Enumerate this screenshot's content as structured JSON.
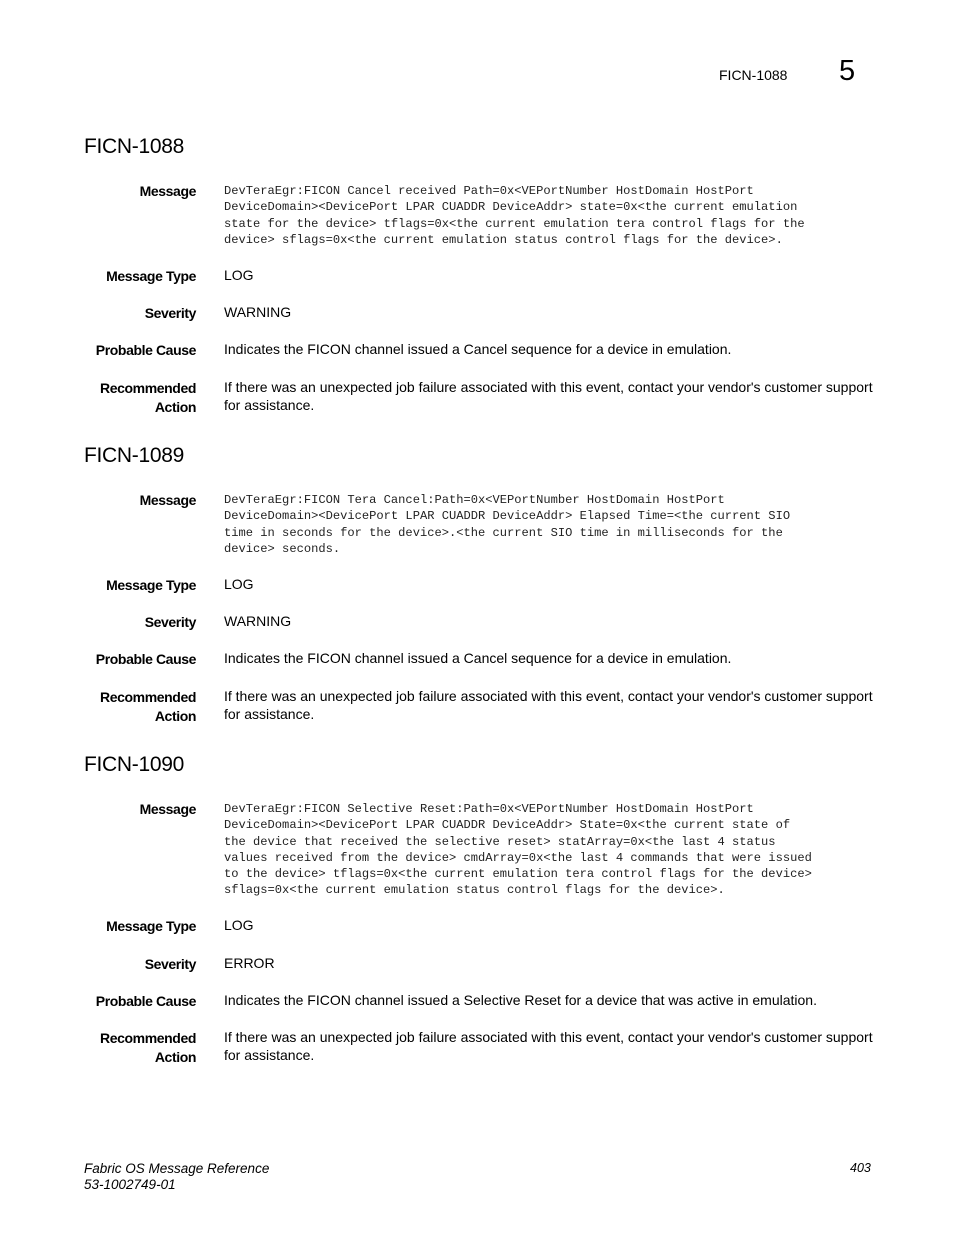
{
  "running_head": {
    "title": "FICN-1088",
    "chapter": "5"
  },
  "labels": {
    "message": "Message",
    "message_type": "Message Type",
    "severity": "Severity",
    "probable_cause": "Probable Cause",
    "recommended_action_line1": "Recommended",
    "recommended_action_line2": "Action"
  },
  "entries": [
    {
      "id": "FICN-1088",
      "message": "DevTeraEgr:FICON Cancel received Path=0x<VEPortNumber HostDomain HostPort\nDeviceDomain><DevicePort LPAR CUADDR DeviceAddr> state=0x<the current emulation\nstate for the device> tflags=0x<the current emulation tera control flags for the\ndevice> sflags=0x<the current emulation status control flags for the device>.",
      "message_type": "LOG",
      "severity": "WARNING",
      "probable_cause": "Indicates the FICON channel issued a Cancel sequence for a device in emulation.",
      "recommended_action": "If there was an unexpected job failure associated with this event, contact your vendor's customer support for assistance."
    },
    {
      "id": "FICN-1089",
      "message": "DevTeraEgr:FICON Tera Cancel:Path=0x<VEPortNumber HostDomain HostPort\nDeviceDomain><DevicePort LPAR CUADDR DeviceAddr> Elapsed Time=<the current SIO\ntime in seconds for the device>.<the current SIO time in milliseconds for the\ndevice> seconds.",
      "message_type": "LOG",
      "severity": "WARNING",
      "probable_cause": "Indicates the FICON channel issued a Cancel sequence for a device in emulation.",
      "recommended_action": "If there was an unexpected job failure associated with this event, contact your vendor's customer support for assistance."
    },
    {
      "id": "FICN-1090",
      "message": "DevTeraEgr:FICON Selective Reset:Path=0x<VEPortNumber HostDomain HostPort\nDeviceDomain><DevicePort LPAR CUADDR DeviceAddr> State=0x<the current state of\nthe device that received the selective reset> statArray=0x<the last 4 status\nvalues received from the device> cmdArray=0x<the last 4 commands that were issued\nto the device> tflags=0x<the current emulation tera control flags for the device>\nsflags=0x<the current emulation status control flags for the device>.",
      "message_type": "LOG",
      "severity": "ERROR",
      "probable_cause": "Indicates the FICON channel issued a Selective Reset for a device that was active in emulation.",
      "recommended_action": "If there was an unexpected job failure associated with this event, contact your vendor's customer support for assistance."
    }
  ],
  "footer": {
    "doc_title": "Fabric OS Message Reference",
    "doc_number": "53-1002749-01",
    "page_number": "403"
  }
}
